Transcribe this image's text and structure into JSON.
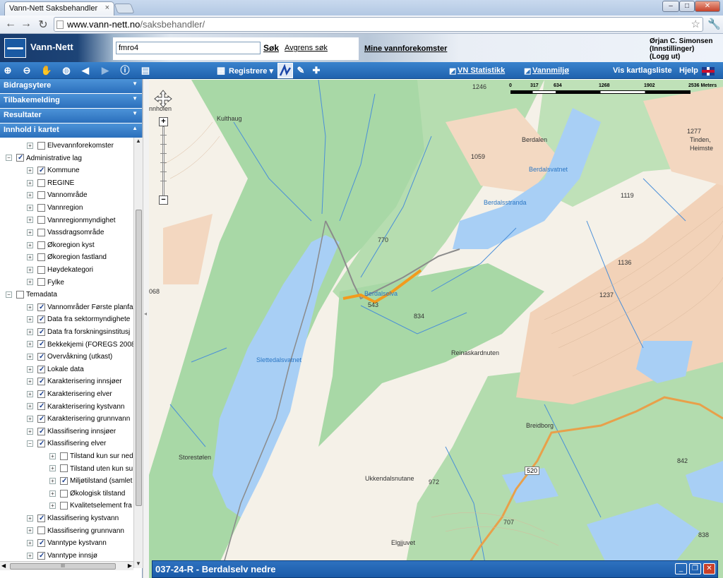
{
  "browser": {
    "tab_title": "Vann-Nett Saksbehandler",
    "tab_close": "×",
    "url_host": "www.vann-nett.no",
    "url_path": "/saksbehandler/",
    "back": "←",
    "forward": "→",
    "reload": "↻",
    "star": "☆",
    "wrench": "🔧",
    "win_min": "–",
    "win_max": "□",
    "win_close": "✕"
  },
  "header": {
    "logo": "Vann-Nett",
    "search_value": "fmro4",
    "search_button": "Søk",
    "refine_link": "Avgrens søk",
    "my_waters": "Mine vannforekomster",
    "user_name": "Ørjan C. Simonsen",
    "settings": "(Innstillinger)",
    "logout": "(Logg ut)"
  },
  "toolbar": {
    "register": "Registrere",
    "vn_stats": "VN Statistikk",
    "vannmiljo": "Vannmiljø",
    "map_list": "Vis kartlagsliste",
    "help": "Hjelp",
    "icons": [
      "zoom-in-icon",
      "zoom-out-icon",
      "pan-hand-icon",
      "zoom-extent-icon",
      "back-icon",
      "forward-icon",
      "info-icon",
      "print-icon"
    ]
  },
  "sidebar": {
    "panels": [
      "Bidragsytere",
      "Tilbakemelding",
      "Resultater",
      "Innhold i kartet"
    ],
    "panel_arrows": [
      "▼",
      "▼",
      "▼",
      "▲"
    ],
    "tree": [
      {
        "label": "Elvevannforekomster",
        "level": 2,
        "checked": false,
        "exp": "+"
      },
      {
        "label": "Administrative lag",
        "level": 1,
        "checked": true,
        "exp": "−"
      },
      {
        "label": "Kommune",
        "level": 2,
        "checked": true,
        "exp": "+"
      },
      {
        "label": "REGINE",
        "level": 2,
        "checked": false,
        "exp": "+"
      },
      {
        "label": "Vannområde",
        "level": 2,
        "checked": false,
        "exp": "+"
      },
      {
        "label": "Vannregion",
        "level": 2,
        "checked": false,
        "exp": "+"
      },
      {
        "label": "Vannregionmyndighet",
        "level": 2,
        "checked": false,
        "exp": "+"
      },
      {
        "label": "Vassdragsområde",
        "level": 2,
        "checked": false,
        "exp": "+"
      },
      {
        "label": "Økoregion kyst",
        "level": 2,
        "checked": false,
        "exp": "+"
      },
      {
        "label": "Økoregion fastland",
        "level": 2,
        "checked": false,
        "exp": "+"
      },
      {
        "label": "Høydekategori",
        "level": 2,
        "checked": false,
        "exp": "+"
      },
      {
        "label": "Fylke",
        "level": 2,
        "checked": false,
        "exp": "+"
      },
      {
        "label": "Temadata",
        "level": 1,
        "checked": false,
        "exp": "−"
      },
      {
        "label": "Vannområder Første planfa",
        "level": 2,
        "checked": true,
        "exp": "+"
      },
      {
        "label": "Data fra sektormyndighete",
        "level": 2,
        "checked": true,
        "exp": "+"
      },
      {
        "label": "Data fra forskningsinstitusj",
        "level": 2,
        "checked": true,
        "exp": "+"
      },
      {
        "label": "Bekkekjemi (FOREGS 2008",
        "level": 2,
        "checked": true,
        "exp": "+"
      },
      {
        "label": "Overvåkning (utkast)",
        "level": 2,
        "checked": true,
        "exp": "+"
      },
      {
        "label": "Lokale data",
        "level": 2,
        "checked": true,
        "exp": "+"
      },
      {
        "label": "Karakterisering innsjøer",
        "level": 2,
        "checked": true,
        "exp": "+"
      },
      {
        "label": "Karakterisering elver",
        "level": 2,
        "checked": true,
        "exp": "+"
      },
      {
        "label": "Karakterisering kystvann",
        "level": 2,
        "checked": true,
        "exp": "+"
      },
      {
        "label": "Karakterisering grunnvann",
        "level": 2,
        "checked": true,
        "exp": "+"
      },
      {
        "label": "Klassifisering innsjøer",
        "level": 2,
        "checked": true,
        "exp": "+"
      },
      {
        "label": "Klassifisering elver",
        "level": 2,
        "checked": true,
        "exp": "−"
      },
      {
        "label": "Tilstand kun sur ned",
        "level": 3,
        "checked": false,
        "exp": "+"
      },
      {
        "label": "Tilstand uten kun su",
        "level": 3,
        "checked": false,
        "exp": "+"
      },
      {
        "label": "Miljøtilstand (samlet",
        "level": 3,
        "checked": true,
        "exp": "+"
      },
      {
        "label": "Økologisk tilstand",
        "level": 3,
        "checked": false,
        "exp": "+"
      },
      {
        "label": "Kvalitetselement fra",
        "level": 3,
        "checked": false,
        "exp": "+"
      },
      {
        "label": "Klassifisering kystvann",
        "level": 2,
        "checked": true,
        "exp": "+"
      },
      {
        "label": "Klassifisering grunnvann",
        "level": 2,
        "checked": false,
        "exp": "+"
      },
      {
        "label": "Vanntype kystvann",
        "level": 2,
        "checked": true,
        "exp": "+"
      },
      {
        "label": "Vanntype innsjø",
        "level": 2,
        "checked": true,
        "exp": "+"
      }
    ],
    "scroll_up": "▲",
    "scroll_down": "▼",
    "scroll_left": "◀",
    "scroll_right": "▶",
    "hthumb": "III"
  },
  "map": {
    "scale_labels": [
      "0",
      "317",
      "634",
      "1268",
      "1902",
      "2536 Meters"
    ],
    "zoom_in": "+",
    "zoom_out": "−",
    "pan_label": "⇕",
    "labels": [
      {
        "t": "Kulthaug",
        "k": "land"
      },
      {
        "t": "1246",
        "k": "land"
      },
      {
        "t": "Berdalen",
        "k": "land"
      },
      {
        "t": "1277",
        "k": "land"
      },
      {
        "t": "Tinden,",
        "k": "land"
      },
      {
        "t": "Heimste",
        "k": "land"
      },
      {
        "t": "1059",
        "k": "land"
      },
      {
        "t": "Berdalsvatnet",
        "k": "water"
      },
      {
        "t": "Berdalsstranda",
        "k": "water"
      },
      {
        "t": "1119",
        "k": "land"
      },
      {
        "t": "770",
        "k": "land"
      },
      {
        "t": "1136",
        "k": "land"
      },
      {
        "t": "Berdalselva",
        "k": "water"
      },
      {
        "t": "543",
        "k": "land"
      },
      {
        "t": "834",
        "k": "land"
      },
      {
        "t": "1237",
        "k": "land"
      },
      {
        "t": "Reinaskardnuten",
        "k": "land"
      },
      {
        "t": "Slettedalsvatnet",
        "k": "water"
      },
      {
        "t": "Breidborg",
        "k": "land"
      },
      {
        "t": "842",
        "k": "land"
      },
      {
        "t": "Storestølen",
        "k": "land"
      },
      {
        "t": "Ukkendalsnutane",
        "k": "land"
      },
      {
        "t": "972",
        "k": "land"
      },
      {
        "t": "707",
        "k": "land"
      },
      {
        "t": "Elgjjuvet",
        "k": "land"
      },
      {
        "t": "838",
        "k": "land"
      },
      {
        "t": "nnholen",
        "k": "land"
      },
      {
        "t": "068",
        "k": "land"
      }
    ],
    "route_shield": "520"
  },
  "infobar": {
    "title": "037-24-R - Berdalselv nedre",
    "min": "_",
    "max": "❐",
    "close": "✕"
  },
  "colors": {
    "water": "#a8cff5",
    "forest": "#a9d9a8",
    "mountain": "#f2cfb4",
    "land": "#f6f2ea",
    "road": "#e8a04a",
    "highlight": "#f29b1d"
  }
}
